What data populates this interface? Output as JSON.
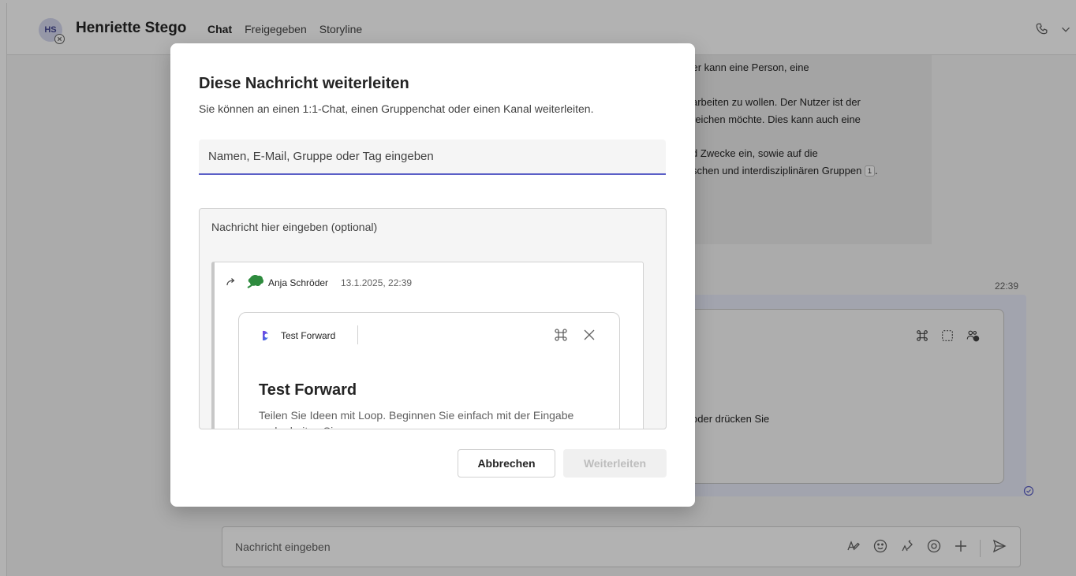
{
  "header": {
    "avatar_initials": "HS",
    "contact_name": "Henriette Stego",
    "tabs": [
      "Chat",
      "Freigegeben",
      "Storyline"
    ],
    "active_tab": "Chat",
    "icons": [
      "phone-icon",
      "chevron-down-icon"
    ]
  },
  "background": {
    "message_lines": [
      "zer kann eine Person, eine",
      "arbeiten zu wollen. Der Nutzer ist der",
      "reichen möchte. Dies kann auch eine",
      "d Zwecke ein, sowie auf die",
      "schen und interdisziplinären Gruppen"
    ],
    "reference_badge": "1",
    "reference_suffix": ".",
    "timestamp": "22:39",
    "loop_text": "oder drücken Sie",
    "compose_placeholder": "Nachricht eingeben"
  },
  "dialog": {
    "title": "Diese Nachricht weiterleiten",
    "subtitle": "Sie können an einen 1:1-Chat, einen Gruppenchat oder einen Kanal weiterleiten.",
    "recipient_placeholder": "Namen, E-Mail, Gruppe oder Tag eingeben",
    "message_placeholder": "Nachricht hier eingeben (optional)",
    "quoted": {
      "author": "Anja Schröder",
      "date": "13.1.2025, 22:39",
      "card": {
        "app_name": "Test Forward",
        "title": "Test Forward",
        "description": "Teilen Sie Ideen mit Loop. Beginnen Sie einfach mit der Eingabe und arbeiten Sie"
      }
    },
    "cancel_label": "Abbrechen",
    "forward_label": "Weiterleiten"
  },
  "colors": {
    "accent": "#5b5fc7",
    "overlay": "rgba(0,0,0,0.30)",
    "disabled_text": "#bdbdbd",
    "loop_gradient_start": "#7b3fe4",
    "loop_gradient_end": "#2f7de1"
  }
}
